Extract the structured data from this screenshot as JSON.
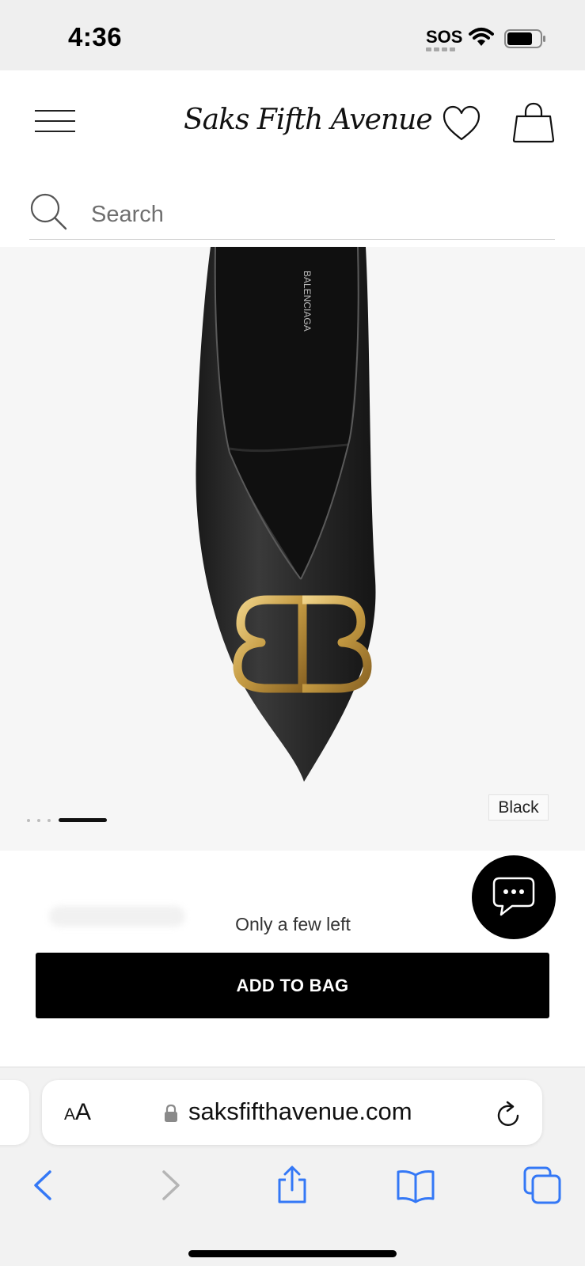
{
  "status_bar": {
    "time": "4:36",
    "carrier_status": "SOS"
  },
  "header": {
    "logo_text": "Saks Fifth Avenue",
    "search_placeholder": "Search"
  },
  "product": {
    "color_label": "Black",
    "carousel_image_count": 4,
    "carousel_active_index": 3
  },
  "purchase": {
    "stock_note": "Only a few left",
    "add_to_bag_label": "ADD TO BAG"
  },
  "browser": {
    "text_size_button_small": "A",
    "text_size_button_large": "A",
    "url": "saksfifthavenue.com"
  },
  "colors": {
    "accent": "#000000",
    "browser_blue": "#3478f6",
    "hardware_gold": "#c9a24a"
  }
}
